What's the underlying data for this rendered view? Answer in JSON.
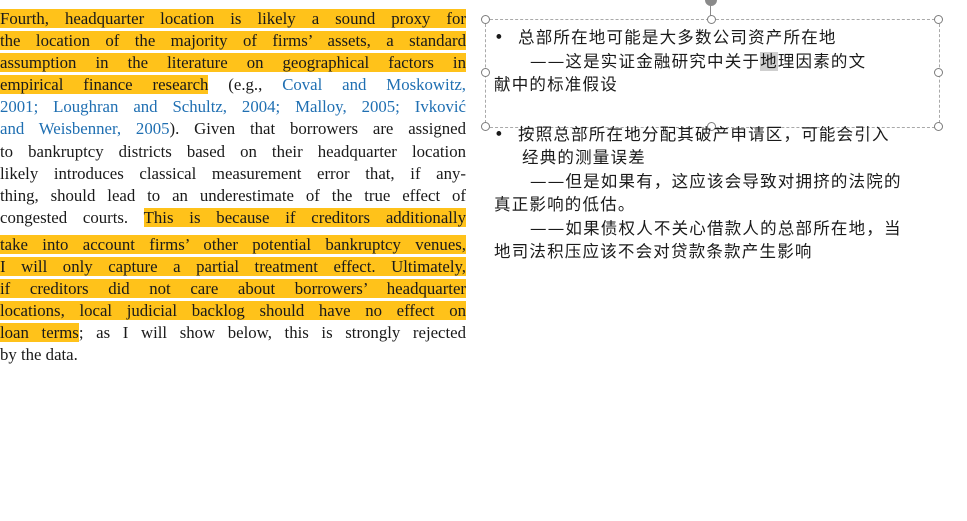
{
  "paper": {
    "lines": [
      {
        "segments": [
          {
            "text": "   Fourth, headquarter location is likely a sound proxy for",
            "hl": true
          }
        ]
      },
      {
        "segments": [
          {
            "text": "the location of the majority of firms’ assets, a standard",
            "hl": true
          }
        ]
      },
      {
        "segments": [
          {
            "text": "assumption in the literature on geographical factors in",
            "hl": true
          }
        ]
      },
      {
        "segments": [
          {
            "text": "empirical finance research",
            "hl": true
          },
          {
            "text": " (e.g., "
          },
          {
            "text": "Coval and Moskowitz,",
            "cite": true
          }
        ]
      },
      {
        "segments": [
          {
            "text": "2001; Loughran and Schultz, 2004; Malloy, 2005; Ivković",
            "cite": true
          }
        ]
      },
      {
        "segments": [
          {
            "text": "and Weisbenner, 2005",
            "cite": true
          },
          {
            "text": "). Given that borrowers are assigned"
          }
        ]
      },
      {
        "segments": [
          {
            "text": "to bankruptcy districts based on their headquarter location"
          }
        ]
      },
      {
        "segments": [
          {
            "text": "likely introduces classical measurement error that, if any-"
          }
        ]
      },
      {
        "segments": [
          {
            "text": "thing, should lead to an underestimate of the true effect of"
          }
        ]
      },
      {
        "segments": [
          {
            "text": "congested courts. "
          },
          {
            "text": "This is because if creditors additionally",
            "hl": true
          }
        ]
      },
      {
        "segments": [
          {
            "text": "take into account firms’ other potential bankruptcy venues,",
            "hl": true
          }
        ],
        "gap": true
      },
      {
        "segments": [
          {
            "text": "I will only capture a partial treatment effect. Ultimately,",
            "hl": true
          }
        ]
      },
      {
        "segments": [
          {
            "text": "if creditors did not care about borrowers’ headquarter",
            "hl": true
          }
        ]
      },
      {
        "segments": [
          {
            "text": "locations, local judicial backlog should have no effect on",
            "hl": true
          }
        ]
      },
      {
        "segments": [
          {
            "text": "loan terms",
            "hl": true
          },
          {
            "text": "; as I will show below, this is strongly rejected"
          }
        ]
      },
      {
        "segments": [
          {
            "text": "by the data."
          }
        ],
        "last": true
      }
    ]
  },
  "notes": {
    "bullet_symbol": "•",
    "block1": {
      "bullet": "总部所在地可能是大多数公司资产所在地",
      "sub_prefix": "——这是实证金融研究中关于",
      "sub_selected": "地",
      "sub_suffix": "理因素的文",
      "cont": "献中的标准假设"
    },
    "block2": {
      "bullet_line1": "按照总部所在地分配其破产申请区，可能会引入",
      "bullet_line2": "经典的测量误差",
      "sub1_line1": "——但是如果有，这应该会导致对拥挤的法院的",
      "sub1_line2": "真正影响的低估。",
      "sub2_line1": "——如果债权人不关心借款人的总部所在地，当",
      "sub2_line2": "地司法积压应该不会对贷款条款产生影响"
    }
  }
}
